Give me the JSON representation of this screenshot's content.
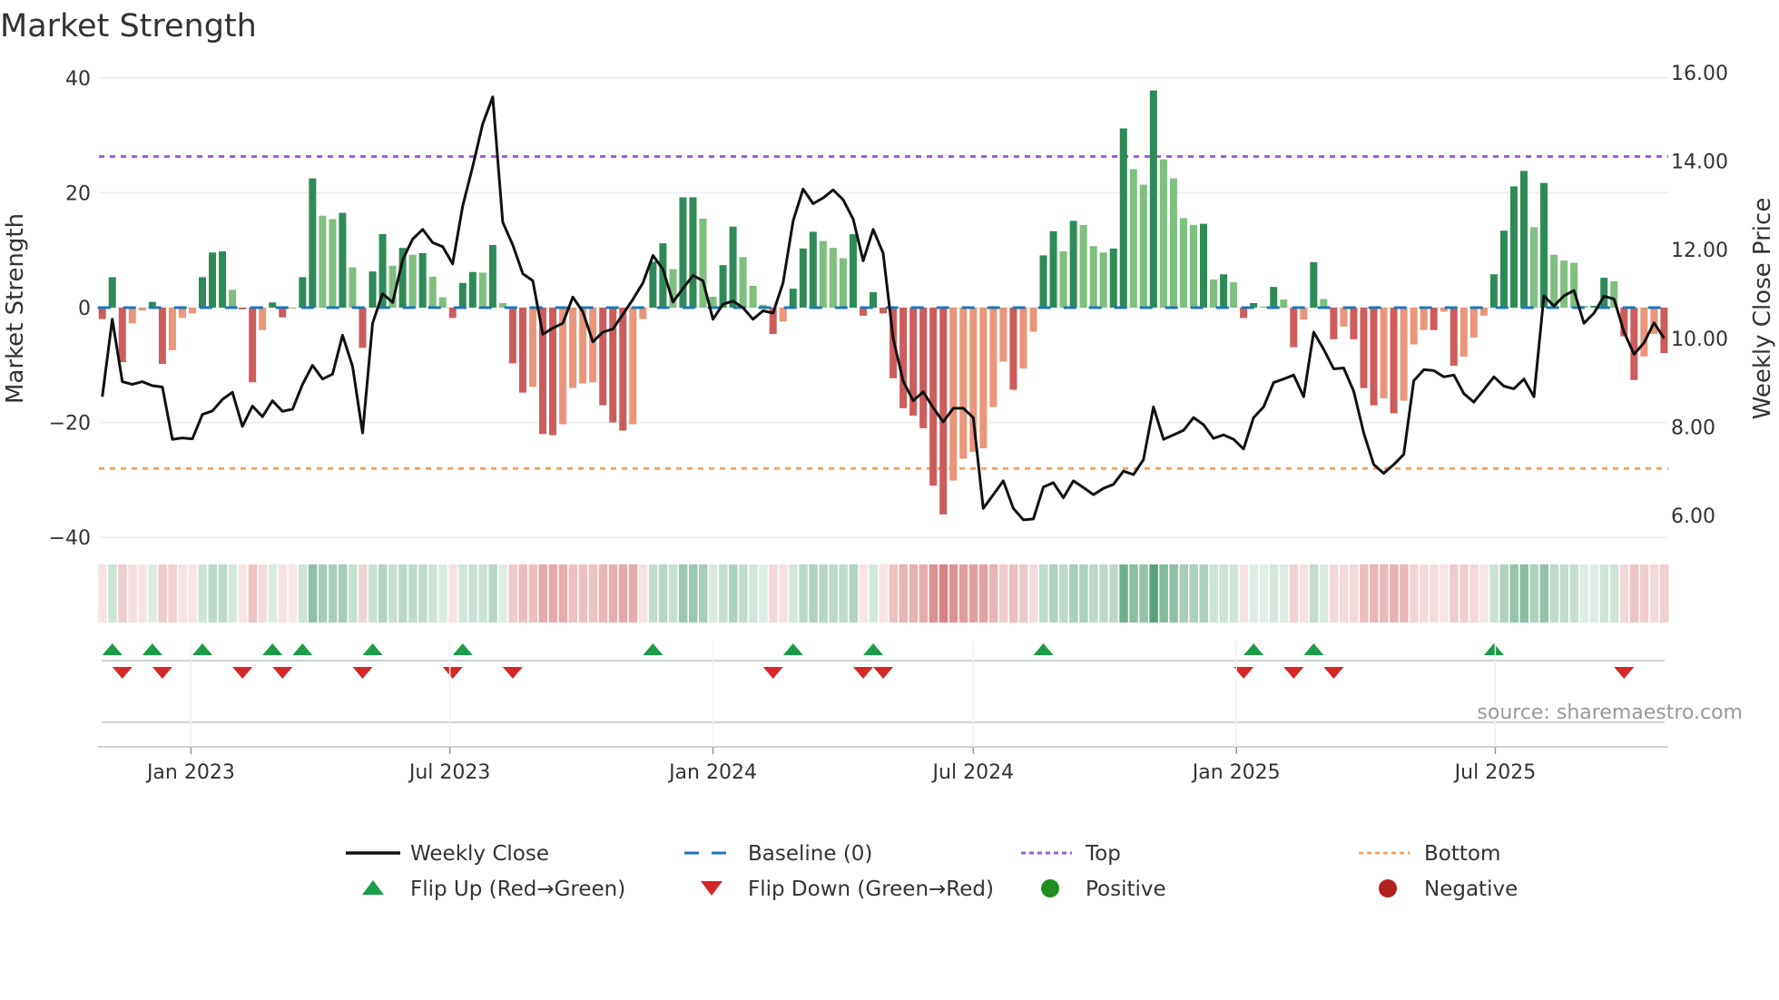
{
  "chart_data": {
    "type": "bar",
    "title": "Market Strength",
    "ylabel": "Market Strength",
    "y2label": "Weekly Close Price",
    "ylim": [
      -40,
      40
    ],
    "y2lim": [
      5.2,
      16.1
    ],
    "yticks": [
      {
        "v": 40,
        "label": "40"
      },
      {
        "v": 20,
        "label": "20"
      },
      {
        "v": 0,
        "label": "0"
      },
      {
        "v": -20,
        "label": "−20"
      },
      {
        "v": -40,
        "label": "−40"
      }
    ],
    "y2ticks": [
      {
        "v": 16,
        "label": "16.00"
      },
      {
        "v": 14,
        "label": "14.00"
      },
      {
        "v": 12,
        "label": "12.00"
      },
      {
        "v": 10,
        "label": "10.00"
      },
      {
        "v": 8,
        "label": "8.00"
      },
      {
        "v": 6,
        "label": "6.00"
      }
    ],
    "xticks": [
      {
        "date": "2023-01-01",
        "label": "Jan 2023"
      },
      {
        "date": "2023-07-01",
        "label": "Jul 2023"
      },
      {
        "date": "2024-01-01",
        "label": "Jan 2024"
      },
      {
        "date": "2024-07-01",
        "label": "Jul 2024"
      },
      {
        "date": "2025-01-01",
        "label": "Jan 2025"
      },
      {
        "date": "2025-07-01",
        "label": "Jul 2025"
      }
    ],
    "start_date": "2022-10-31",
    "frequency": "weekly",
    "grid": true,
    "top_level": 26.3,
    "bottom_level": -28.0,
    "legend_position": "bottom-center",
    "series": [
      {
        "name": "Market Strength",
        "type": "bar",
        "values": [
          -2,
          5.3,
          -9.5,
          -2.7,
          -0.5,
          1,
          -9.8,
          -7.4,
          -1.8,
          -1,
          5.3,
          9.6,
          9.8,
          3.1,
          -0.3,
          -13,
          -3.9,
          0.9,
          -1.7,
          -0.1,
          5.3,
          22.5,
          16,
          15.4,
          16.5,
          7,
          -7,
          6.3,
          12.8,
          7.3,
          10.4,
          9.2,
          9.5,
          5.4,
          1.8,
          -1.8,
          4.3,
          6.2,
          6.1,
          10.9,
          0.8,
          -9.7,
          -14.8,
          -13.8,
          -22,
          -22.2,
          -20.3,
          -14,
          -13.2,
          -13,
          -17,
          -20,
          -21.4,
          -20.3,
          -2,
          8,
          11.2,
          6.7,
          19.2,
          19.2,
          15.5,
          1.9,
          7.4,
          14.1,
          8.8,
          3.8,
          0.5,
          -4.6,
          -2.4,
          3.3,
          10.3,
          13.2,
          11.6,
          10.4,
          8.6,
          12.8,
          -1.4,
          2.7,
          -1,
          -12.3,
          -17.5,
          -18.8,
          -21,
          -31,
          -36,
          -30.1,
          -26.3,
          -25.1,
          -24.5,
          -17.3,
          -9.4,
          -14.3,
          -10.6,
          -4.2,
          9.1,
          13.3,
          9.8,
          15.1,
          14.4,
          10.7,
          9.6,
          10.3,
          31.2,
          24.1,
          21.4,
          37.8,
          25.8,
          22.5,
          15.6,
          14.4,
          14.6,
          4.9,
          5.8,
          4.4,
          -1.8,
          0.8,
          0.2,
          3.6,
          1.4,
          -6.9,
          -2.1,
          7.9,
          1.5,
          -5.5,
          -3.3,
          -5.5,
          -14,
          -17,
          -15.8,
          -18.4,
          -16.2,
          -6.4,
          -3.9,
          -3.9,
          -0.7,
          -10.1,
          -8.5,
          -5.2,
          -1.4,
          5.8,
          13.4,
          21.1,
          23.8,
          14,
          21.7,
          9.2,
          8.2,
          7.8,
          0.3,
          0.3,
          5.2,
          4.6,
          -5,
          -12.6,
          -8.5,
          -4.6,
          -7.9
        ]
      },
      {
        "name": "Weekly Close",
        "type": "line",
        "axis": "right",
        "values": [
          8.68,
          10.43,
          9.02,
          8.96,
          9.02,
          8.93,
          8.9,
          7.72,
          7.75,
          7.73,
          8.28,
          8.36,
          8.62,
          8.78,
          8.01,
          8.47,
          8.23,
          8.59,
          8.35,
          8.4,
          8.96,
          9.39,
          9.08,
          9.19,
          10.07,
          9.37,
          7.86,
          10.34,
          11.01,
          10.81,
          11.77,
          12.24,
          12.46,
          12.16,
          12.07,
          11.68,
          12.99,
          13.88,
          14.84,
          15.45,
          12.62,
          12.11,
          11.46,
          11.3,
          10.09,
          10.23,
          10.34,
          10.93,
          10.6,
          9.92,
          10.14,
          10.21,
          10.54,
          10.88,
          11.25,
          11.87,
          11.56,
          10.82,
          11.12,
          11.42,
          11.3,
          10.43,
          10.77,
          10.84,
          10.69,
          10.43,
          10.62,
          10.57,
          11.25,
          12.65,
          13.37,
          13.04,
          13.17,
          13.35,
          13.13,
          12.69,
          11.75,
          12.46,
          11.92,
          9.99,
          9.03,
          8.59,
          8.79,
          8.43,
          8.11,
          8.42,
          8.42,
          8.21,
          6.16,
          6.47,
          6.78,
          6.16,
          5.9,
          5.92,
          6.64,
          6.74,
          6.4,
          6.78,
          6.63,
          6.47,
          6.61,
          6.7,
          7.0,
          6.92,
          7.26,
          8.45,
          7.72,
          7.82,
          7.92,
          8.21,
          8.05,
          7.74,
          7.82,
          7.72,
          7.5,
          8.21,
          8.45,
          9.0,
          9.08,
          9.17,
          8.68,
          10.14,
          9.75,
          9.31,
          9.33,
          8.8,
          7.86,
          7.15,
          6.95,
          7.15,
          7.38,
          9.04,
          9.29,
          9.27,
          9.13,
          9.17,
          8.75,
          8.56,
          8.84,
          9.13,
          8.92,
          8.86,
          9.08,
          8.68,
          10.96,
          10.73,
          10.96,
          11.08,
          10.34,
          10.57,
          10.95,
          10.89,
          10.14,
          9.64,
          9.9,
          10.35,
          10.0
        ]
      }
    ],
    "legend": [
      {
        "key": "weekly_close",
        "label": "Weekly Close"
      },
      {
        "key": "baseline",
        "label": "Baseline (0)"
      },
      {
        "key": "top",
        "label": "Top"
      },
      {
        "key": "bottom",
        "label": "Bottom"
      },
      {
        "key": "flip_up",
        "label": "Flip Up (Red→Green)"
      },
      {
        "key": "flip_down",
        "label": "Flip Down (Green→Red)"
      },
      {
        "key": "positive",
        "label": "Positive"
      },
      {
        "key": "negative",
        "label": "Negative"
      }
    ],
    "annotation": "source: sharemaestro.com"
  },
  "colors": {
    "pos_strong": "#2e8b57",
    "pos_weak": "#7fbf7f",
    "neg_strong": "#cd5c5c",
    "neg_weak": "#e9967a",
    "line": "#111111",
    "baseline": "#1f77b4",
    "top": "#9b5de5",
    "bottom": "#f4a460",
    "flip_up": "#1a9c48",
    "flip_down": "#d62728",
    "positive": "#228b22",
    "negative": "#b22222"
  }
}
